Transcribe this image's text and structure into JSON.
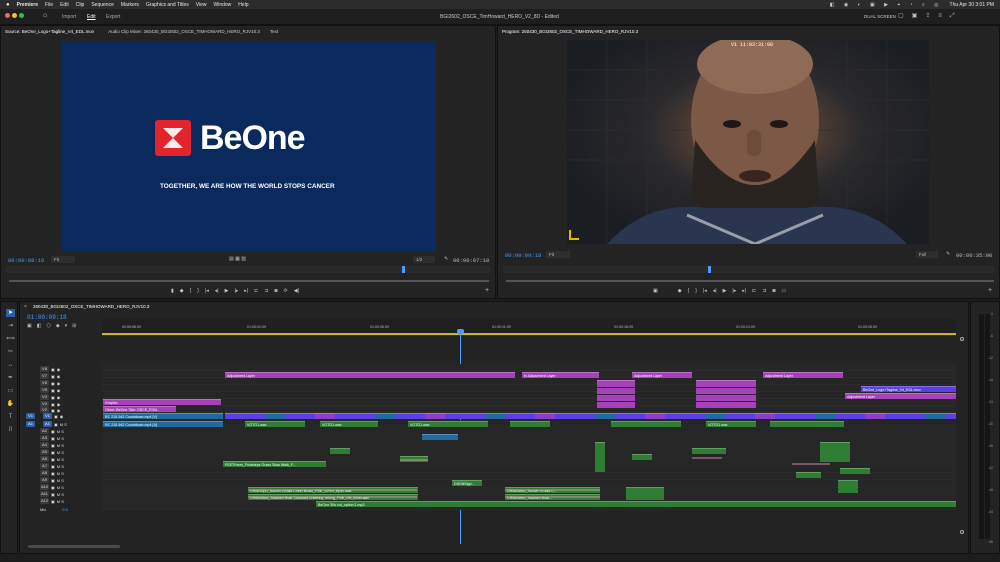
{
  "menubar": {
    "apple": "",
    "app_name": "Premiere",
    "items": [
      "File",
      "Edit",
      "Clip",
      "Sequence",
      "Markers",
      "Graphics and Titles",
      "View",
      "Window",
      "Help"
    ],
    "clock": "Thu Apr 30  3:01 PM"
  },
  "workspace": {
    "tabs": [
      "Import",
      "Edit",
      "Export"
    ],
    "active_tab": "Edit",
    "project_title": "BGI2602_OSCE_TimHoward_HERO_V2_8D",
    "edit_status": "- Edited",
    "dual_screen": "DUAL SCREEN"
  },
  "source": {
    "tab_label": "Source: BeOne_Logo+Tagline_V4_EDL.mov",
    "tab2": "Audio Clip Mixer: 260430_BGI2602_OSCE_TIMHOWARD_HERO_RJV10.3",
    "tab3": "Text",
    "logo_text": "BeOne",
    "tagline": "TOGETHER, WE ARE HOW THE WORLD STOPS CANCER",
    "timecode_in": "00:00:08:16",
    "fit": "Fit",
    "resolution": "1/2",
    "duration": "00:00:07:10",
    "bg_color": "#0a2a5e"
  },
  "program": {
    "tab_label": "Program: 260430_BGI2602_OSCE_TIMHOWARD_HERO_RJV10.3",
    "overlay_tc": "V1  11:03:31:08",
    "timecode_in": "00:00:09:18",
    "fit": "Fit",
    "resolution": "Full",
    "duration": "00:00:35:00"
  },
  "timeline": {
    "seq_tab": "260430_BGI2602_OSCE_TIMHOWARD_HERO_RJV10.3",
    "timecode": "01:00:09:18",
    "ruler": [
      "00:59:56:09",
      "01:00:01:09",
      "01:00:06:09",
      "01:00:11:09",
      "01:00:16:09",
      "01:00:21:09",
      "01:00:26:09"
    ],
    "video_tracks": [
      "V8",
      "V7",
      "V6",
      "V5",
      "V4",
      "V3",
      "V2",
      "V1"
    ],
    "audio_tracks": [
      "A1",
      "A2",
      "A3",
      "A4",
      "A5",
      "A6",
      "A7",
      "A8",
      "A9",
      "A10",
      "A11",
      "A12"
    ],
    "mix_label": "Mix",
    "mix_value": "0.0",
    "clips": {
      "adj1": "Adjustment Layer",
      "adj2": "fx Adjustment Layer",
      "adj3": "Adjustment Layer",
      "adj4": "Adjustment Layer",
      "adj5": "Adjustment Layer",
      "graphic": "Graphic",
      "title": "Client: BeOne Title: OSCE_R30L",
      "logo": "BeOne_Logo+Tagline_V4_EDL.mov",
      "v1a": "RC 210-942 Countdown.mp4 [V]",
      "a1a": "RC 210-942 Countdown.mp4 [A]",
      "vo1": "VOTO1.wav",
      "vo2": "VOTO1.wav",
      "vo3": "VOTO1.wav",
      "vo4": "VOTO1.wav",
      "fx1": "FEETHmm_Footsteps Grass Slow Walk_F...",
      "crowd1": "CRWDSprt_Soccer Crowd Cheer Brazil_PSE_O2VH_Epsh.wav",
      "crowd2": "CRWDMisc_Stadium Roar Constant Cheering Yelling_PSE_OH_BGM.wav",
      "crowd3": "CRWDMisc_Soccer Crowd C...",
      "crowd4": "CRWDMisc_Stadium Roar...",
      "music": "BeOne 30s cut_option 1.mp3",
      "ds": "DSGNSign..."
    },
    "meter_scale": [
      "0",
      "-6",
      "-12",
      "-18",
      "-24",
      "-30",
      "-36",
      "-42",
      "-48",
      "-54",
      "dB"
    ]
  }
}
